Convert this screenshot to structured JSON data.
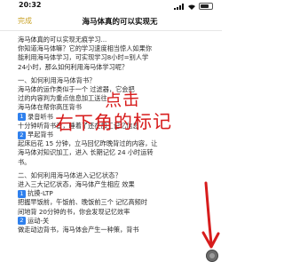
{
  "status_bar": {
    "time": "20:32"
  },
  "nav": {
    "done_label": "完成",
    "title": "海马体真的可以实现无"
  },
  "content_lines": {
    "l1": "海马体真的可以实现无痕学习...",
    "l2": "你知道海马体嘛？它的学习速度相当惊人如果你",
    "l3": "能利用海马体学习，可实现学习8小时=别人学",
    "l4": "24小时，那么如何利用海马体学习呢？",
    "h1": "一、如何利用海马体背书？",
    "l5": "海马体的运作类似于一个 过滤器，它会把",
    "l6": "过的内容判为重点信息加工送往",
    "l7": "海马体在帮你高压背书",
    "s1": "录音听书",
    "l8": "十分钟听背书音，睡着了还在加工记忆信息",
    "s2": "早起背书",
    "l9": "起床后花 15 分钟，立马回忆昨晚背过的内容，让",
    "l10": "海马体对知识加工，进入 长期记忆 24 小时运转",
    "l11": "书。",
    "h2": "二、如何利用海马体进入记忆状态？",
    "l12": "进入三大记忆状态，海马体产生相应 效果",
    "s3": "抗摸-LTP",
    "l13": "把握早饭前，午饭前、晚饭前三个 记忆高频时",
    "l14": "间地背 20分钟的书，你会发现记忆效率",
    "s4": "运动-关",
    "l15": "做走动边背书，海马体会产生一种策，背书"
  },
  "badges": {
    "n1": "1",
    "n2": "2",
    "n3": "1",
    "n4": "2"
  },
  "annotation": {
    "line1": "点击",
    "line2": "右下角的标记"
  },
  "colors": {
    "accent": "#c9a227",
    "annotation": "#d71c1c",
    "badge": "#2f80ed"
  }
}
